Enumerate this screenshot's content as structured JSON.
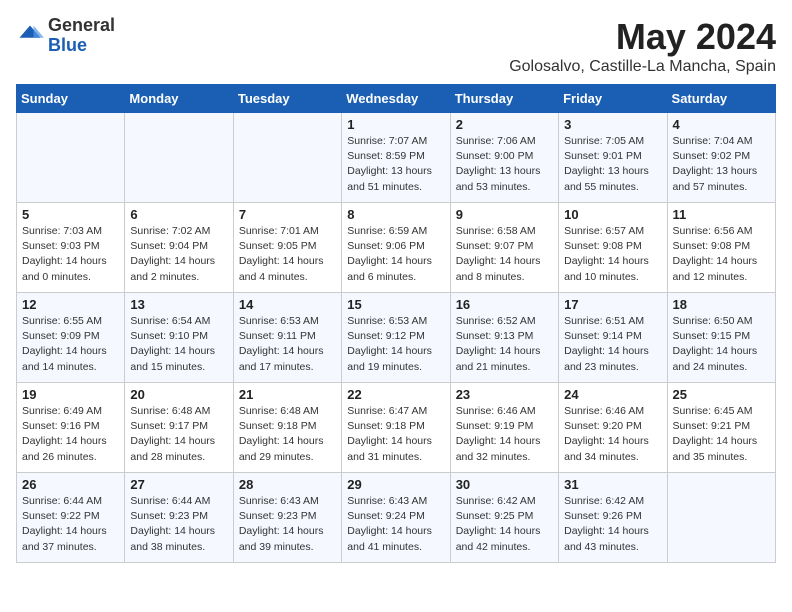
{
  "header": {
    "logo_general": "General",
    "logo_blue": "Blue",
    "month_title": "May 2024",
    "location": "Golosalvo, Castille-La Mancha, Spain"
  },
  "weekdays": [
    "Sunday",
    "Monday",
    "Tuesday",
    "Wednesday",
    "Thursday",
    "Friday",
    "Saturday"
  ],
  "weeks": [
    [
      {
        "day": "",
        "info": ""
      },
      {
        "day": "",
        "info": ""
      },
      {
        "day": "",
        "info": ""
      },
      {
        "day": "1",
        "info": "Sunrise: 7:07 AM\nSunset: 8:59 PM\nDaylight: 13 hours\nand 51 minutes."
      },
      {
        "day": "2",
        "info": "Sunrise: 7:06 AM\nSunset: 9:00 PM\nDaylight: 13 hours\nand 53 minutes."
      },
      {
        "day": "3",
        "info": "Sunrise: 7:05 AM\nSunset: 9:01 PM\nDaylight: 13 hours\nand 55 minutes."
      },
      {
        "day": "4",
        "info": "Sunrise: 7:04 AM\nSunset: 9:02 PM\nDaylight: 13 hours\nand 57 minutes."
      }
    ],
    [
      {
        "day": "5",
        "info": "Sunrise: 7:03 AM\nSunset: 9:03 PM\nDaylight: 14 hours\nand 0 minutes."
      },
      {
        "day": "6",
        "info": "Sunrise: 7:02 AM\nSunset: 9:04 PM\nDaylight: 14 hours\nand 2 minutes."
      },
      {
        "day": "7",
        "info": "Sunrise: 7:01 AM\nSunset: 9:05 PM\nDaylight: 14 hours\nand 4 minutes."
      },
      {
        "day": "8",
        "info": "Sunrise: 6:59 AM\nSunset: 9:06 PM\nDaylight: 14 hours\nand 6 minutes."
      },
      {
        "day": "9",
        "info": "Sunrise: 6:58 AM\nSunset: 9:07 PM\nDaylight: 14 hours\nand 8 minutes."
      },
      {
        "day": "10",
        "info": "Sunrise: 6:57 AM\nSunset: 9:08 PM\nDaylight: 14 hours\nand 10 minutes."
      },
      {
        "day": "11",
        "info": "Sunrise: 6:56 AM\nSunset: 9:08 PM\nDaylight: 14 hours\nand 12 minutes."
      }
    ],
    [
      {
        "day": "12",
        "info": "Sunrise: 6:55 AM\nSunset: 9:09 PM\nDaylight: 14 hours\nand 14 minutes."
      },
      {
        "day": "13",
        "info": "Sunrise: 6:54 AM\nSunset: 9:10 PM\nDaylight: 14 hours\nand 15 minutes."
      },
      {
        "day": "14",
        "info": "Sunrise: 6:53 AM\nSunset: 9:11 PM\nDaylight: 14 hours\nand 17 minutes."
      },
      {
        "day": "15",
        "info": "Sunrise: 6:53 AM\nSunset: 9:12 PM\nDaylight: 14 hours\nand 19 minutes."
      },
      {
        "day": "16",
        "info": "Sunrise: 6:52 AM\nSunset: 9:13 PM\nDaylight: 14 hours\nand 21 minutes."
      },
      {
        "day": "17",
        "info": "Sunrise: 6:51 AM\nSunset: 9:14 PM\nDaylight: 14 hours\nand 23 minutes."
      },
      {
        "day": "18",
        "info": "Sunrise: 6:50 AM\nSunset: 9:15 PM\nDaylight: 14 hours\nand 24 minutes."
      }
    ],
    [
      {
        "day": "19",
        "info": "Sunrise: 6:49 AM\nSunset: 9:16 PM\nDaylight: 14 hours\nand 26 minutes."
      },
      {
        "day": "20",
        "info": "Sunrise: 6:48 AM\nSunset: 9:17 PM\nDaylight: 14 hours\nand 28 minutes."
      },
      {
        "day": "21",
        "info": "Sunrise: 6:48 AM\nSunset: 9:18 PM\nDaylight: 14 hours\nand 29 minutes."
      },
      {
        "day": "22",
        "info": "Sunrise: 6:47 AM\nSunset: 9:18 PM\nDaylight: 14 hours\nand 31 minutes."
      },
      {
        "day": "23",
        "info": "Sunrise: 6:46 AM\nSunset: 9:19 PM\nDaylight: 14 hours\nand 32 minutes."
      },
      {
        "day": "24",
        "info": "Sunrise: 6:46 AM\nSunset: 9:20 PM\nDaylight: 14 hours\nand 34 minutes."
      },
      {
        "day": "25",
        "info": "Sunrise: 6:45 AM\nSunset: 9:21 PM\nDaylight: 14 hours\nand 35 minutes."
      }
    ],
    [
      {
        "day": "26",
        "info": "Sunrise: 6:44 AM\nSunset: 9:22 PM\nDaylight: 14 hours\nand 37 minutes."
      },
      {
        "day": "27",
        "info": "Sunrise: 6:44 AM\nSunset: 9:23 PM\nDaylight: 14 hours\nand 38 minutes."
      },
      {
        "day": "28",
        "info": "Sunrise: 6:43 AM\nSunset: 9:23 PM\nDaylight: 14 hours\nand 39 minutes."
      },
      {
        "day": "29",
        "info": "Sunrise: 6:43 AM\nSunset: 9:24 PM\nDaylight: 14 hours\nand 41 minutes."
      },
      {
        "day": "30",
        "info": "Sunrise: 6:42 AM\nSunset: 9:25 PM\nDaylight: 14 hours\nand 42 minutes."
      },
      {
        "day": "31",
        "info": "Sunrise: 6:42 AM\nSunset: 9:26 PM\nDaylight: 14 hours\nand 43 minutes."
      },
      {
        "day": "",
        "info": ""
      }
    ]
  ]
}
